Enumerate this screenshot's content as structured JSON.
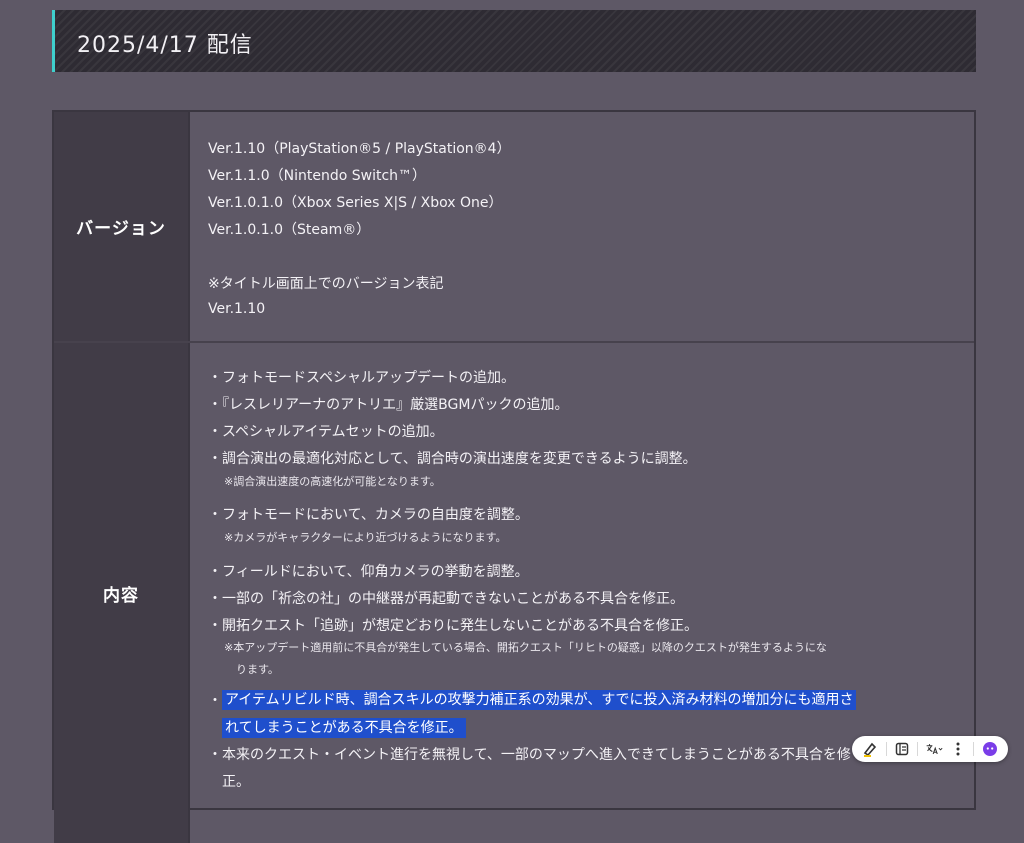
{
  "header": {
    "title": "2025/4/17 配信"
  },
  "version": {
    "label": "バージョン",
    "lines": [
      "Ver.1.10（PlayStation®5 / PlayStation®4）",
      "Ver.1.1.0（Nintendo Switch™）",
      "Ver.1.0.1.0（Xbox Series X|S / Xbox One）",
      "Ver.1.0.1.0（Steam®）"
    ],
    "title_note": "※タイトル画面上でのバージョン表記",
    "title_version": "Ver.1.10"
  },
  "content": {
    "label": "内容",
    "items": [
      "・フォトモードスペシャルアップデートの追加。",
      "・『レスレリアーナのアトリエ』厳選BGMパックの追加。",
      "・スペシャルアイテムセットの追加。",
      "・調合演出の最適化対応として、調合時の演出速度を変更できるように調整。",
      "・フォトモードにおいて、カメラの自由度を調整。",
      "・フィールドにおいて、仰角カメラの挙動を調整。",
      "・一部の「祈念の社」の中継器が再起動できないことがある不具合を修正。",
      "・開拓クエスト「追跡」が想定どおりに発生しないことがある不具合を修正。",
      "・",
      "・本来のクエスト・イベント進行を無視して、一部のマップへ進入できてしまうことがある不具合を修",
      "正。"
    ],
    "notes": [
      "※調合演出速度の高速化が可能となります。",
      "※カメラがキャラクターにより近づけるようになります。",
      "※本アップデート適用前に不具合が発生している場合、開拓クエスト「リヒトの疑惑」以降のクエストが発生するようにな",
      "ります。"
    ],
    "highlighted": [
      "アイテムリビルド時、調合スキルの攻撃力補正系の効果が、すでに投入済み材料の増加分にも適用さ",
      "れてしまうことがある不具合を修正。"
    ]
  },
  "toolbar": {
    "icons": [
      "highlighter-icon",
      "notes-icon",
      "translate-icon",
      "more-icon",
      "assistant-icon"
    ]
  }
}
